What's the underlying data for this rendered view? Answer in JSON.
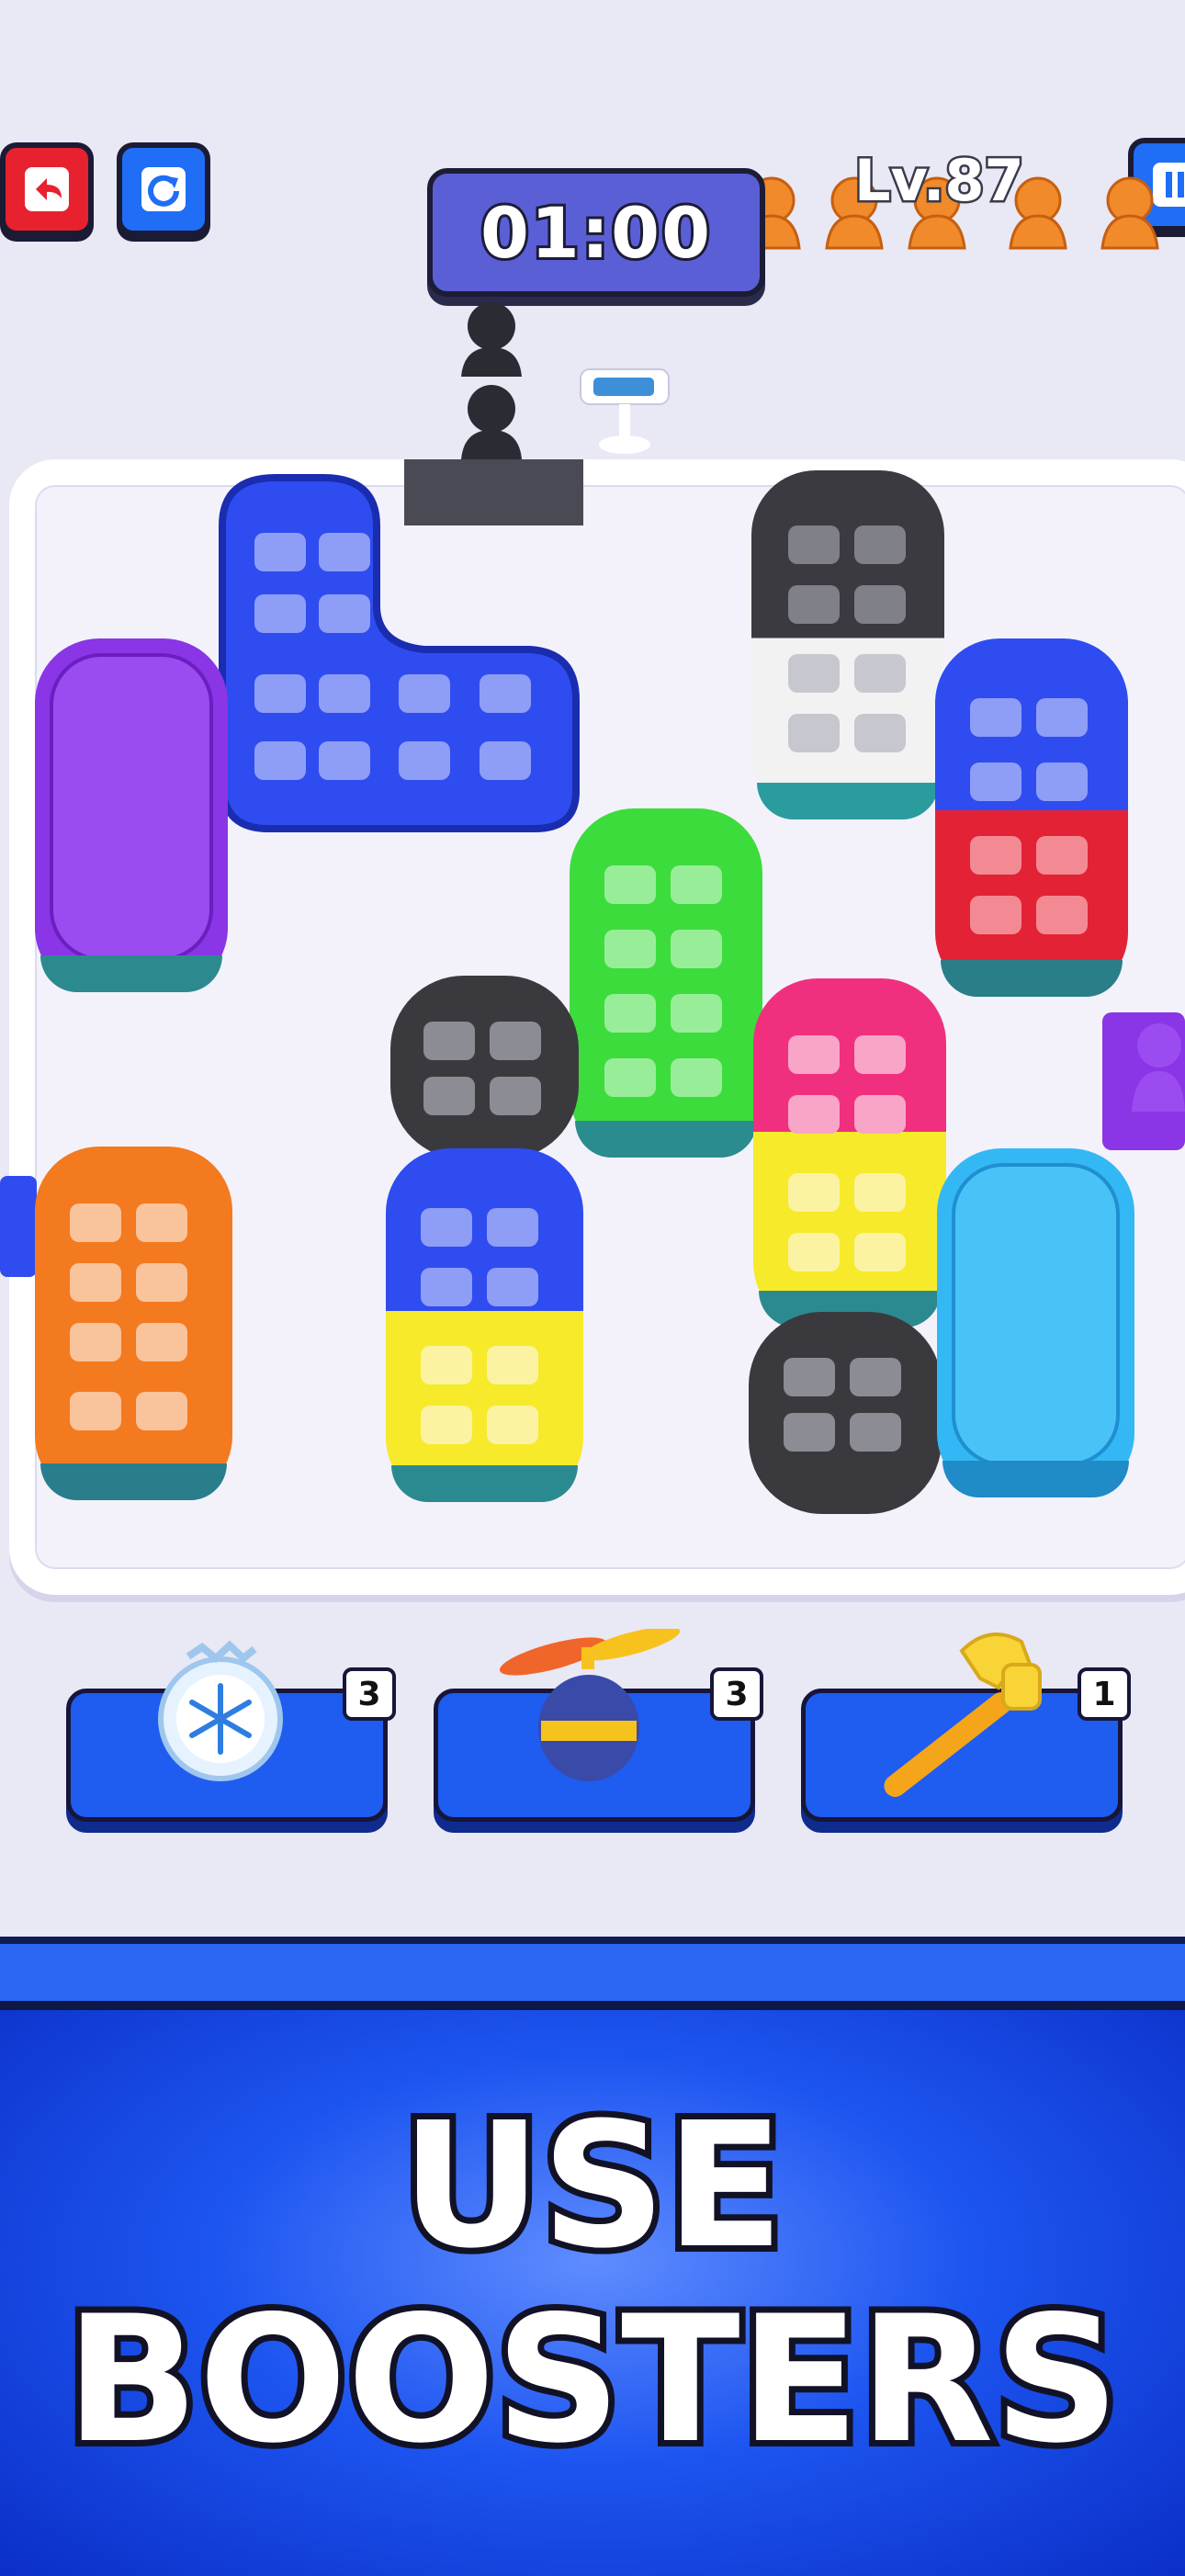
{
  "hud": {
    "timer": "01:00",
    "level": "Lv.87",
    "undo_icon": "undo-icon",
    "restart_icon": "restart-icon",
    "pause_icon": "pause-icon"
  },
  "boosters": [
    {
      "name": "freeze",
      "icon": "snowflake-icon",
      "count": "3"
    },
    {
      "name": "propeller",
      "icon": "propeller-icon",
      "count": "3"
    },
    {
      "name": "hammer",
      "icon": "hammer-icon",
      "count": "1"
    }
  ],
  "banner": {
    "line1": "USE",
    "line2": "BOOSTERS"
  },
  "colors": {
    "blue": "#2f4cf0",
    "purple": "#8a35e6",
    "green": "#3ddc3d",
    "red": "#e32236",
    "pink": "#f0307f",
    "yellow": "#f6ea2b",
    "orange": "#f47a1f",
    "cyan": "#34b8f5",
    "dark": "#3a3a3e",
    "white": "#f2f2f2"
  }
}
